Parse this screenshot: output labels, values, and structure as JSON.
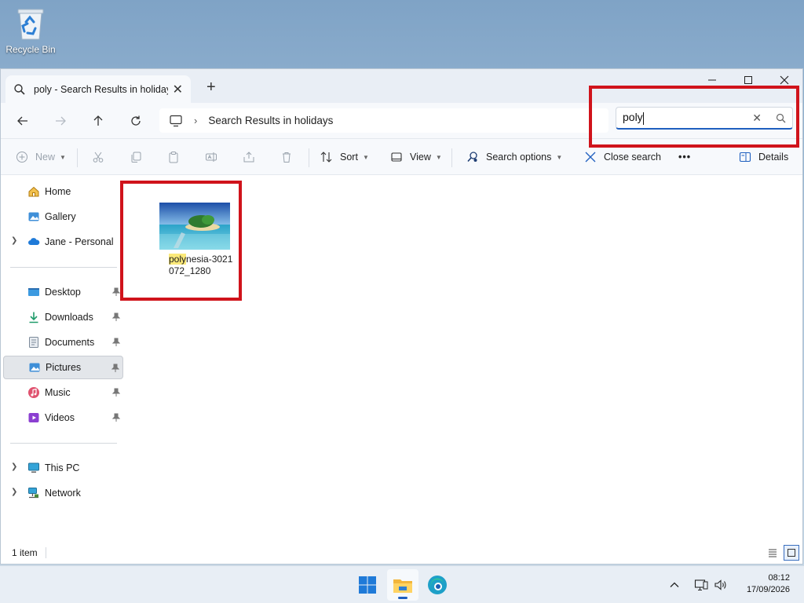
{
  "desktop": {
    "recycle_bin_label": "Recycle Bin"
  },
  "window": {
    "tab_title": "poly - Search Results in holidays",
    "address_path": "Search Results in holidays",
    "search_value": "poly"
  },
  "toolbar": {
    "new_label": "New",
    "sort_label": "Sort",
    "view_label": "View",
    "search_options_label": "Search options",
    "close_search_label": "Close search",
    "more_label": "•••",
    "details_label": "Details"
  },
  "sidebar": {
    "home": "Home",
    "gallery": "Gallery",
    "onedrive": "Jane - Personal",
    "desktop": "Desktop",
    "downloads": "Downloads",
    "documents": "Documents",
    "pictures": "Pictures",
    "music": "Music",
    "videos": "Videos",
    "this_pc": "This PC",
    "network": "Network"
  },
  "results": {
    "file_name_match": "poly",
    "file_name_rest": "nesia-3021072_1280"
  },
  "status": {
    "item_count": "1 item"
  },
  "taskbar": {
    "time": "08:12",
    "date": "17/09/2026"
  },
  "colors": {
    "accent": "#1f5fbf",
    "highlight": "#fbe97a",
    "annotation_red": "#d0131b"
  }
}
